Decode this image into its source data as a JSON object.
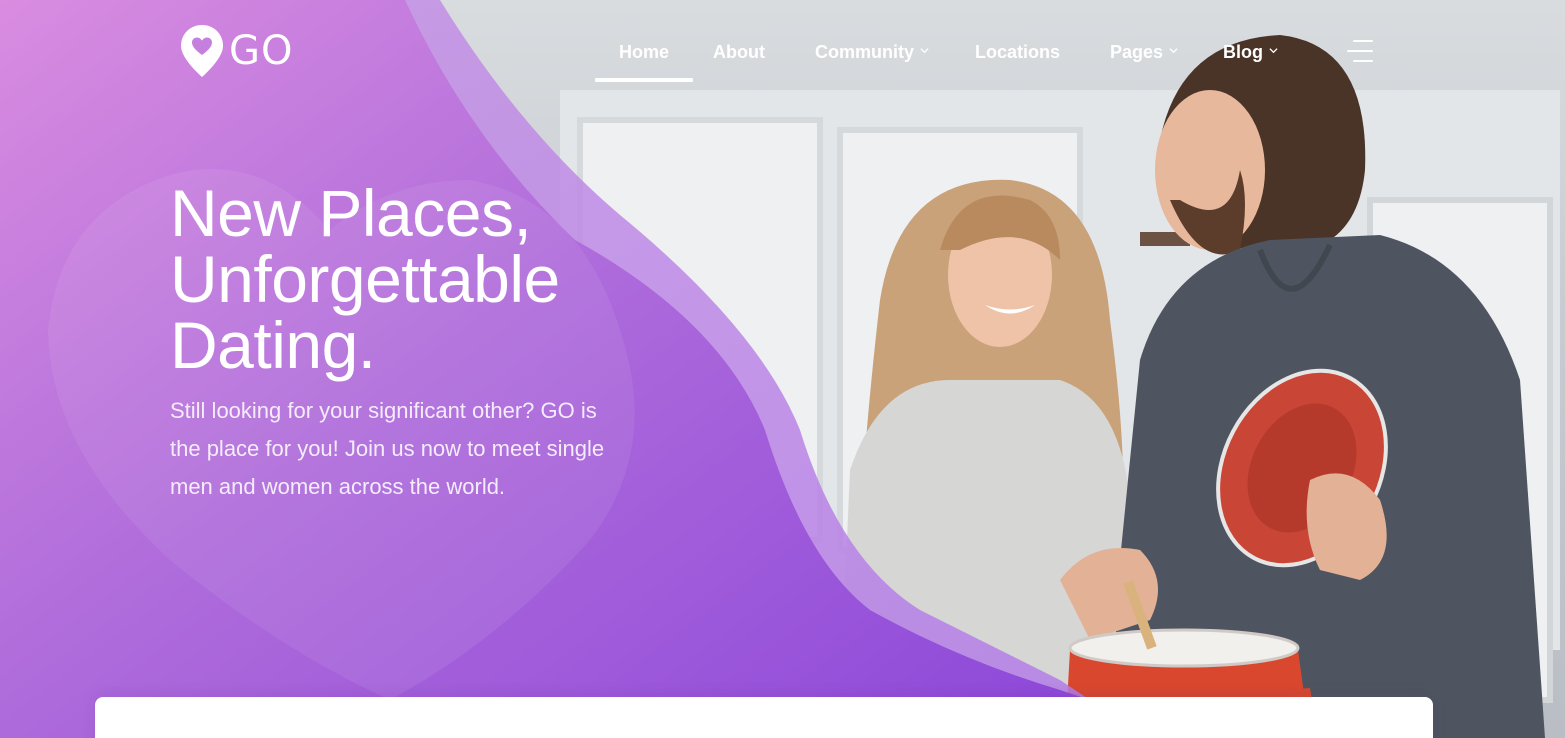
{
  "brand": {
    "logo_text": "GO",
    "logo_icon": "heart-location-pin-icon",
    "primary_color": "#a45fdc",
    "accent_color": "#8f4ad9"
  },
  "nav": {
    "items": [
      {
        "label": "Home",
        "active": true,
        "dropdown": false
      },
      {
        "label": "About",
        "active": false,
        "dropdown": false
      },
      {
        "label": "Community",
        "active": false,
        "dropdown": true
      },
      {
        "label": "Locations",
        "active": false,
        "dropdown": false
      },
      {
        "label": "Pages",
        "active": false,
        "dropdown": true
      },
      {
        "label": "Blog",
        "active": false,
        "dropdown": true
      }
    ],
    "menu_icon": "hamburger-menu-icon"
  },
  "hero": {
    "title_lines": [
      "New Places,",
      "Unforgettable",
      "Dating."
    ],
    "subtitle": "Still looking for your significant other? GO is the place for you! Join us now to meet single men and women across the world."
  }
}
